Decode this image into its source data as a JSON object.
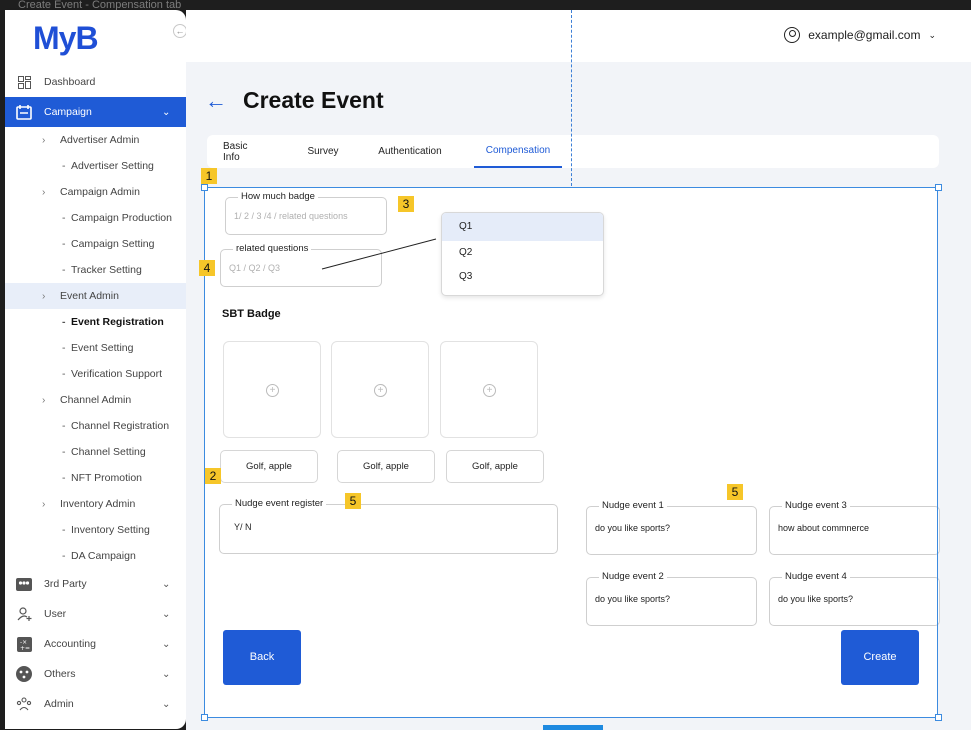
{
  "frame_label": "Create Event - Compensation tab",
  "logo": "MyB",
  "collapse_glyph": "←",
  "account": {
    "email": "example@gmail.com"
  },
  "sidebar": {
    "top_items": {
      "dashboard": "Dashboard",
      "campaign": "Campaign",
      "third_party": "3rd Party",
      "user": "User",
      "accounting": "Accounting",
      "others": "Others",
      "admin": "Admin"
    },
    "campaign_children": {
      "advertiser_admin": "Advertiser Admin",
      "advertiser_setting": "Advertiser Setting",
      "campaign_admin": "Campaign Admin",
      "campaign_production": "Campaign Production",
      "campaign_setting": "Campaign Setting",
      "tracker_setting": "Tracker Setting",
      "event_admin": "Event Admin",
      "event_registration": "Event Registration",
      "event_setting": "Event Setting",
      "verification_support": "Verification Support",
      "channel_admin": "Channel Admin",
      "channel_registration": "Channel Registration",
      "channel_setting": "Channel Setting",
      "nft_promotion": "NFT Promotion",
      "inventory_admin": "Inventory Admin",
      "inventory_setting": "Inventory Setting",
      "da_campaign": "DA Campaign"
    }
  },
  "page": {
    "title": "Create Event",
    "tabs": [
      "Basic Info",
      "Survey",
      "Authentication",
      "Compensation"
    ]
  },
  "form": {
    "badge_field": {
      "legend": "How much badge",
      "placeholder": "1/ 2 / 3 /4 / related questions"
    },
    "questions_field": {
      "legend": "related questions",
      "placeholder": "Q1 / Q2 / Q3"
    },
    "dropdown_options": [
      "Q1",
      "Q2",
      "Q3"
    ],
    "sbt_title": "SBT Badge",
    "badge_labels": [
      "Golf, apple",
      "Golf, apple",
      "Golf, apple"
    ],
    "nudge_register": {
      "legend": "Nudge event register",
      "value": "Y/ N"
    },
    "nudge_events": [
      {
        "legend": "Nudge event 1",
        "value": "do you like sports?"
      },
      {
        "legend": "Nudge event 3",
        "value": "how about commnerce"
      },
      {
        "legend": "Nudge event 2",
        "value": "do you like sports?"
      },
      {
        "legend": "Nudge event 4",
        "value": "do you like sports?"
      }
    ],
    "back_label": "Back",
    "create_label": "Create"
  },
  "annotations": [
    "1",
    "2",
    "3",
    "4",
    "5",
    "5"
  ],
  "colors": {
    "accent": "#1f5bd6",
    "annotation": "#f6c629",
    "selection": "#3c8be0"
  }
}
